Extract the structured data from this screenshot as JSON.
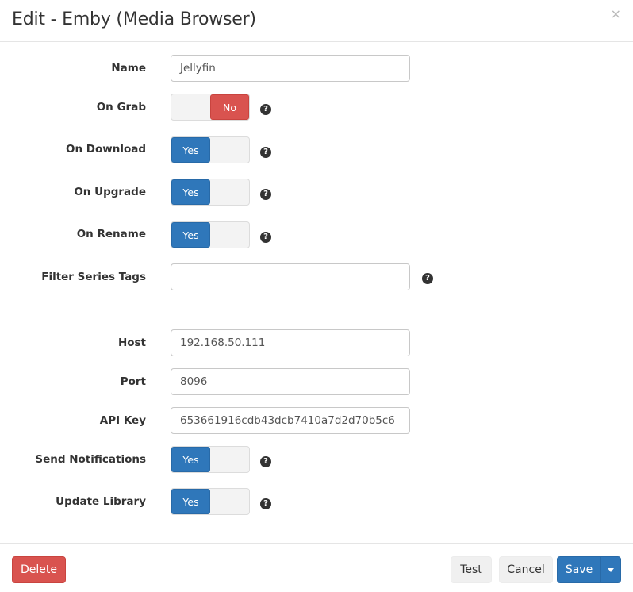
{
  "modal": {
    "title": "Edit - Emby (Media Browser)",
    "close_glyph": "×"
  },
  "fields": {
    "name": {
      "label": "Name",
      "value": "Jellyfin"
    },
    "on_grab": {
      "label": "On Grab",
      "state": "No",
      "enabled": false
    },
    "on_download": {
      "label": "On Download",
      "state": "Yes",
      "enabled": true
    },
    "on_upgrade": {
      "label": "On Upgrade",
      "state": "Yes",
      "enabled": true
    },
    "on_rename": {
      "label": "On Rename",
      "state": "Yes",
      "enabled": true
    },
    "filter_series_tags": {
      "label": "Filter Series Tags",
      "value": ""
    },
    "host": {
      "label": "Host",
      "value": "192.168.50.111"
    },
    "port": {
      "label": "Port",
      "value": "8096"
    },
    "api_key": {
      "label": "API Key",
      "value": "653661916cdb43dcb7410a7d2d70b5c6"
    },
    "send_notifications": {
      "label": "Send Notifications",
      "state": "Yes",
      "enabled": true
    },
    "update_library": {
      "label": "Update Library",
      "state": "Yes",
      "enabled": true
    }
  },
  "help_glyph": "?",
  "footer": {
    "delete_label": "Delete",
    "test_label": "Test",
    "cancel_label": "Cancel",
    "save_label": "Save"
  },
  "colors": {
    "primary": "#2f77ba",
    "danger": "#d9534f",
    "default_button": "#f0f0f0"
  },
  "icons": {
    "help": "question-circle-icon",
    "close": "close-icon",
    "save_dropdown": "caret-down-icon"
  }
}
